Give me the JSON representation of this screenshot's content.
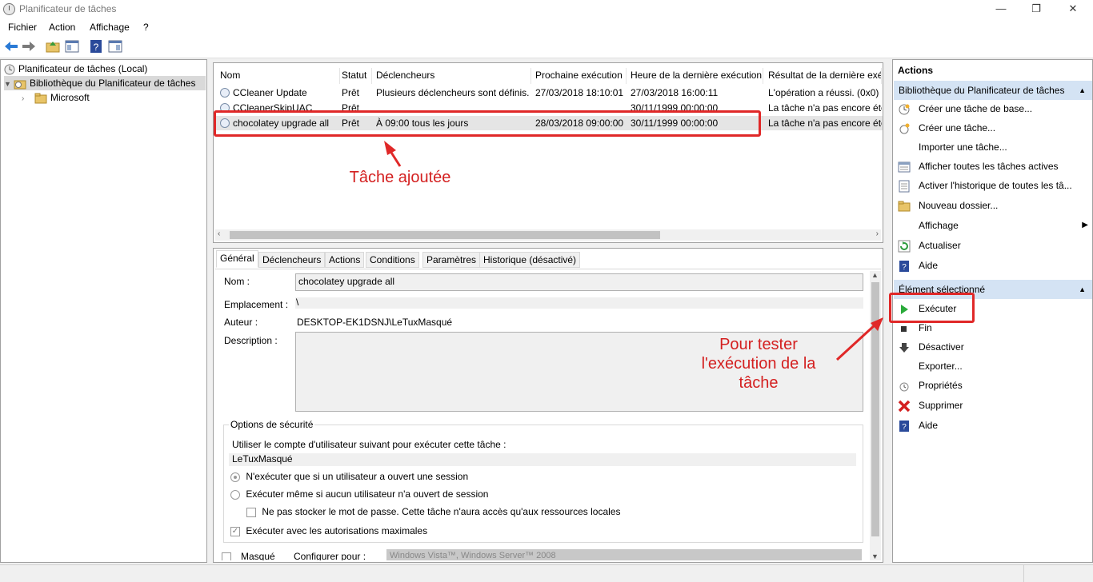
{
  "window": {
    "title": "Planificateur de tâches",
    "minimize": "—",
    "restore": "❐",
    "close": "✕"
  },
  "menu": [
    "Fichier",
    "Action",
    "Affichage",
    "?"
  ],
  "tree": {
    "root": "Planificateur de tâches (Local)",
    "library": "Bibliothèque du Planificateur de tâches",
    "microsoft": "Microsoft"
  },
  "task_list": {
    "columns": [
      "Nom",
      "Statut",
      "Déclencheurs",
      "Prochaine exécution",
      "Heure de la dernière exécution",
      "Résultat de la dernière exécution"
    ],
    "rows": [
      {
        "name": "CCleaner Update",
        "status": "Prêt",
        "triggers": "Plusieurs déclencheurs sont définis.",
        "next": "27/03/2018 18:10:01",
        "last": "27/03/2018 16:00:11",
        "result": "L'opération a réussi. (0x0)"
      },
      {
        "name": "CCleanerSkipUAC",
        "status": "Prêt",
        "triggers": "",
        "next": "",
        "last": "30/11/1999 00:00:00",
        "result": "La tâche n'a pas encore été exécutée"
      },
      {
        "name": "chocolatey upgrade all",
        "status": "Prêt",
        "triggers": "À 09:00 tous les jours",
        "next": "28/03/2018 09:00:00",
        "last": "30/11/1999 00:00:00",
        "result": "La tâche n'a pas encore été exécutée"
      }
    ]
  },
  "detail": {
    "tabs": [
      "Général",
      "Déclencheurs",
      "Actions",
      "Conditions",
      "Paramètres",
      "Historique (désactivé)"
    ],
    "name_label": "Nom :",
    "name_value": "chocolatey upgrade all",
    "location_label": "Emplacement :",
    "location_value": "\\",
    "author_label": "Auteur :",
    "author_value": "DESKTOP-EK1DSNJ\\LeTuxMasqué",
    "description_label": "Description :",
    "description_value": "",
    "security_title": "Options de sécurité",
    "security_account_label": "Utiliser le compte d'utilisateur suivant pour exécuter cette tâche :",
    "security_account_value": "LeTuxMasqué",
    "opt_logged_on": "N'exécuter que si un utilisateur a ouvert une session",
    "opt_any": "Exécuter même si aucun utilisateur n'a ouvert de session",
    "opt_no_password": "Ne pas stocker le mot de passe. Cette tâche n'aura accès qu'aux ressources locales",
    "opt_highest": "Exécuter avec les autorisations maximales",
    "hidden_label": "Masqué",
    "configure_label": "Configurer pour :",
    "configure_value": "Windows Vista™, Windows Server™ 2008"
  },
  "actions_pane": {
    "title": "Actions",
    "library_header": "Bibliothèque du Planificateur de tâches",
    "library_items": [
      "Créer une tâche de base...",
      "Créer une tâche...",
      "Importer une tâche...",
      "Afficher toutes les tâches actives",
      "Activer l'historique de toutes les tâ...",
      "Nouveau dossier...",
      "Affichage",
      "Actualiser",
      "Aide"
    ],
    "selected_header": "Élément sélectionné",
    "selected_items": [
      "Exécuter",
      "Fin",
      "Désactiver",
      "Exporter...",
      "Propriétés",
      "Supprimer",
      "Aide"
    ]
  },
  "annotations": {
    "added": "Tâche ajoutée",
    "test": "Pour tester l'exécution de la tâche"
  },
  "colors": {
    "annotation": "#e02828",
    "section_header": "#d4e3f4",
    "selected_row": "#e5e5e5"
  }
}
